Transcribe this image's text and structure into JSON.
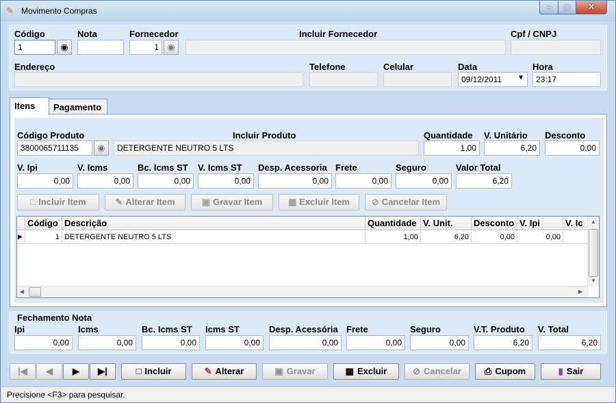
{
  "window": {
    "title": "Movimento Compras",
    "icon": "cart-icon"
  },
  "header": {
    "codigo_label": "Código",
    "codigo_value": "1",
    "nota_label": "Nota",
    "nota_value": "",
    "fornecedor_label": "Fornecedor",
    "fornecedor_value": "1",
    "incluir_fornecedor_label": "Incluir Fornecedor",
    "cpf_label": "Cpf / CNPJ",
    "endereco_label": "Endereço",
    "telefone_label": "Telefone",
    "celular_label": "Celular",
    "data_label": "Data",
    "data_value": "09/12/2011",
    "hora_label": "Hora",
    "hora_value": "23:17"
  },
  "tabs": [
    {
      "label": "Itens",
      "active": true
    },
    {
      "label": "Pagamento",
      "active": false
    }
  ],
  "item": {
    "codigo_produto_label": "Código Produto",
    "codigo_produto_value": "3800065711135",
    "incluir_produto_label": "Incluir Produto",
    "produto_value": "DETERGENTE NEUTRO 5 LTS",
    "quantidade_label": "Quantidade",
    "quantidade_value": "1,00",
    "v_unitario_label": "V. Unitário",
    "v_unitario_value": "6,20",
    "desconto_label": "Desconto",
    "desconto_value": "0,00",
    "v_ipi_label": "V. Ipi",
    "v_ipi_value": "0,00",
    "v_icms_label": "V. Icms",
    "v_icms_value": "0,00",
    "bc_icms_st_label": "Bc. Icms ST",
    "bc_icms_st_value": "0,00",
    "v_icms_st_label": "V. Icms ST",
    "v_icms_st_value": "0,00",
    "desp_acessoria_label": "Desp. Acessoria",
    "desp_acessoria_value": "0,00",
    "frete_label": "Frete",
    "frete_value": "0,00",
    "seguro_label": "Seguro",
    "seguro_value": "0,00",
    "valor_total_label": "Valor Total",
    "valor_total_value": "6,20"
  },
  "item_buttons": {
    "incluir": "Incluir Item",
    "alterar": "Alterar Item",
    "gravar": "Gravar Item",
    "excluir": "Excluir Item",
    "cancelar": "Cancelar Item"
  },
  "grid": {
    "columns": [
      "Código",
      "Descrição",
      "Quantidade",
      "V. Unit.",
      "Desconto",
      "V. Ipi",
      "V. Ic"
    ],
    "rows": [
      [
        "1",
        "DETERGENTE NEUTRO 5 LTS",
        "1,00",
        "6,20",
        "0,00",
        "0,00",
        ""
      ]
    ]
  },
  "fechamento": {
    "title": "Fechamento Nota",
    "ipi_label": "Ipi",
    "ipi_value": "0,00",
    "icms_label": "Icms",
    "icms_value": "0,00",
    "bc_icms_st_label": "Bc. Icms ST",
    "bc_icms_st_value": "0,00",
    "icms_st_label": "Icms ST",
    "icms_st_value": "0,00",
    "desp_acessoria_label": "Desp. Acessória",
    "desp_acessoria_value": "0,00",
    "frete_label": "Frete",
    "frete_value": "0,00",
    "seguro_label": "Seguro",
    "seguro_value": "0,00",
    "vt_produto_label": "V.T. Produto",
    "vt_produto_value": "6,20",
    "v_total_label": "V. Total",
    "v_total_value": "6,20"
  },
  "toolbar": {
    "incluir": "Incluir",
    "alterar": "Alterar",
    "gravar": "Gravar",
    "excluir": "Excluir",
    "cancelar": "Cancelar",
    "cupom": "Cupom",
    "sair": "Sair"
  },
  "status": {
    "text": "Precisione <F3> para pesquisar."
  }
}
